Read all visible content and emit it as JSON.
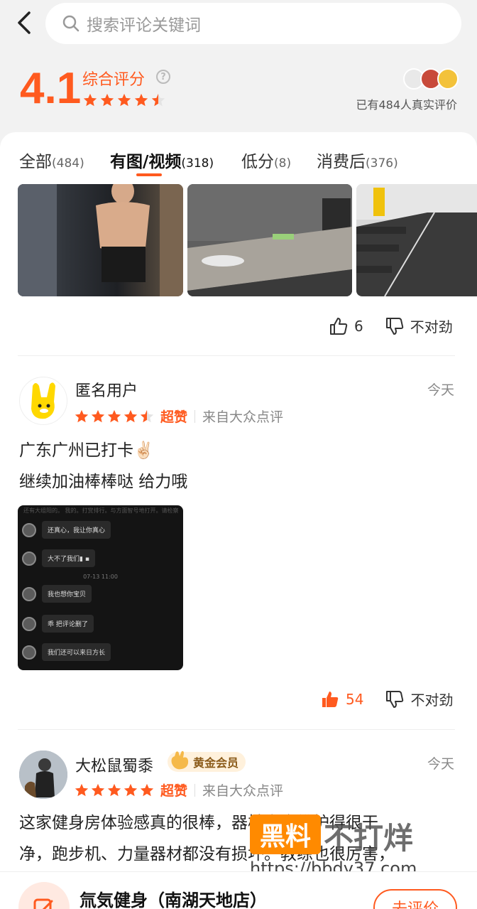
{
  "search": {
    "placeholder": "搜索评论关键词"
  },
  "summary": {
    "score": "4.1",
    "score_label": "综合评分",
    "help_icon": "?",
    "stars": 4.5,
    "total_text": "已有484人真实评价"
  },
  "tabs": [
    {
      "label": "全部",
      "count": "(484)",
      "active": false
    },
    {
      "label": "有图/视频",
      "count": "(318)",
      "active": true
    },
    {
      "label": "低分",
      "count": "(8)",
      "active": false
    },
    {
      "label": "消费后",
      "count": "(376)",
      "active": false
    }
  ],
  "review0": {
    "like_count": "6",
    "dislike_label": "不对劲"
  },
  "review1": {
    "username": "匿名用户",
    "date": "今天",
    "stars": 4.5,
    "rating_word": "超赞",
    "source": "来自大众点评",
    "line1": "广东广州已打卡✌🏻",
    "line2": "继续加油棒棒哒 给力哦",
    "chat": {
      "top": "还有大组阳的。 我的。打赏排行。与方面智号地打开。请检察",
      "messages": [
        "还真心，我让你真心",
        "大不了我们▮ ▪",
        "我也想你宝贝",
        "乖 把评论删了",
        "我们还可以来日方长"
      ],
      "time": "07-13 11:00"
    },
    "like_count": "54",
    "dislike_label": "不对劲"
  },
  "review2": {
    "username": "大松鼠蜀黍",
    "badge": "黄金会员",
    "date": "今天",
    "stars": 5,
    "rating_word": "超赞",
    "source": "来自大众点评",
    "line1": "这家健身房体验感真的很棒，器械齐全维护得很干",
    "line2": "净，跑步机、力量器材都没有损坏。教练也很厉害，"
  },
  "watermark": {
    "box": "黑料",
    "text": "不打烊",
    "url": "https://bbdy37.com"
  },
  "bottombar": {
    "shop_name": "氚気健身（南湖天地店）",
    "write_label": "去评价"
  },
  "colors": {
    "accent": "#ff5a1f",
    "star": "#ff5a1f"
  }
}
